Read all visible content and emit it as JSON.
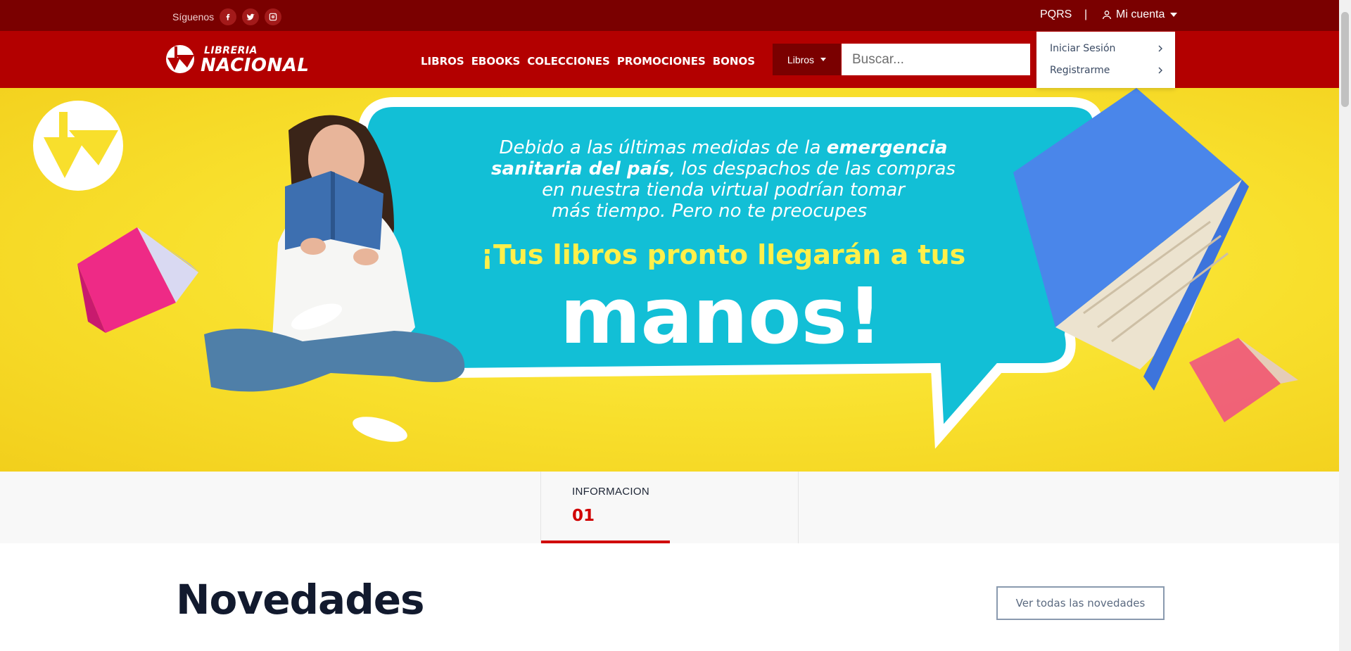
{
  "topbar": {
    "follow_label": "Síguenos",
    "social": [
      "facebook-icon",
      "twitter-icon",
      "instagram-icon"
    ],
    "pqrs": "PQRS",
    "separator": "|",
    "account_label": "Mi cuenta"
  },
  "nav": {
    "logo_small": "LIBRERIA",
    "logo_big": "NACIONAL",
    "links": [
      "LIBROS",
      "EBOOKS",
      "COLECCIONES",
      "PROMOCIONES",
      "BONOS"
    ],
    "search_category": "Libros",
    "search_placeholder": "Buscar..."
  },
  "account_menu": {
    "items": [
      "Iniciar Sesión",
      "Registrarme"
    ]
  },
  "banner": {
    "line1a": "Debido a las últimas medidas de la ",
    "line1b": "emergencia",
    "line2a": "sanitaria del país",
    "line2b": ", los despachos de las compras",
    "line3": "en nuestra tienda virtual podrían tomar",
    "line4": "más tiempo. Pero no te preocupes",
    "headline1": "¡Tus libros pronto llegarán a tus",
    "headline2": "manos!"
  },
  "tabs": [
    {
      "label": "INFORMACION",
      "number": "01"
    }
  ],
  "novedades": {
    "title": "Novedades",
    "button": "Ver todas las novedades"
  },
  "colors": {
    "topbar": "#7a0000",
    "navbar": "#b30000",
    "accent": "#d00000",
    "banner_yellow": "#f8df2c",
    "bubble_teal": "#12bfd6"
  }
}
